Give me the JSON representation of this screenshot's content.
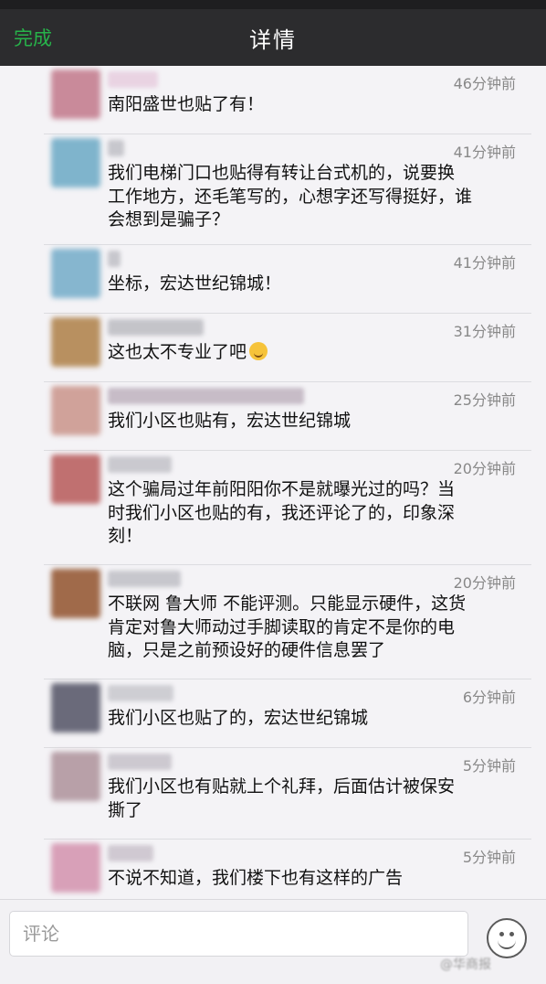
{
  "navbar": {
    "done_label": "完成",
    "title": "详情"
  },
  "comments": [
    {
      "time": "46分钟前",
      "text": "南阳盛世也贴了有！",
      "emoji": false,
      "avatar_color": "#c98a9a",
      "name_color": "#e6c9dc"
    },
    {
      "time": "41分钟前",
      "text": "我们电梯门口也贴得有转让台式机的，说要换\n工作地方，还毛笔写的，心想字还写得挺好，谁\n会想到是骗子？",
      "emoji": false,
      "avatar_color": "#7fb4cc",
      "name_color": "#b9b9c0"
    },
    {
      "time": "41分钟前",
      "text": "坐标，宏达世纪锦城！",
      "emoji": false,
      "avatar_color": "#86b6cf",
      "name_color": "#b9b9c0"
    },
    {
      "time": "31分钟前",
      "text": "这也太不专业了吧",
      "emoji": true,
      "emoji_icon": "sweat-smile-emoji",
      "avatar_color": "#b89060",
      "name_color": "#b5b5bb"
    },
    {
      "time": "25分钟前",
      "text": "我们小区也贴有，宏达世纪锦城",
      "emoji": false,
      "avatar_color": "#d0a29a",
      "name_color": "#b8aab8"
    },
    {
      "time": "20分钟前",
      "text": "这个骗局过年前阳阳你不是就曝光过的吗？当\n时我们小区也贴的有，我还评论了的，印象深\n刻！",
      "emoji": false,
      "avatar_color": "#c07070",
      "name_color": "#bcbcc2"
    },
    {
      "time": "20分钟前",
      "text": "不联网 鲁大师 不能评测。只能显示硬件，这货\n肯定对鲁大师动过手脚读取的肯定不是你的电\n脑，只是之前预设好的硬件信息罢了",
      "emoji": false,
      "avatar_color": "#a06a4a",
      "name_color": "#b9b9c0"
    },
    {
      "time": "6分钟前",
      "text": "我们小区也贴了的，宏达世纪锦城",
      "emoji": false,
      "avatar_color": "#6a6a7a",
      "name_color": "#c2c2c8"
    },
    {
      "time": "5分钟前",
      "text": "我们小区也有贴就上个礼拜，后面估计被保安\n撕了",
      "emoji": false,
      "avatar_color": "#b8a0a8",
      "name_color": "#c0bcc4"
    },
    {
      "time": "5分钟前",
      "text": "不说不知道，我们楼下也有这样的广告",
      "emoji": false,
      "avatar_color": "#d8a0b8",
      "name_color": "#c4bcc6"
    }
  ],
  "input": {
    "placeholder": "评论"
  },
  "emoji_button": {
    "icon": "smiley-face-icon"
  },
  "watermark": {
    "text": "@华商报"
  }
}
